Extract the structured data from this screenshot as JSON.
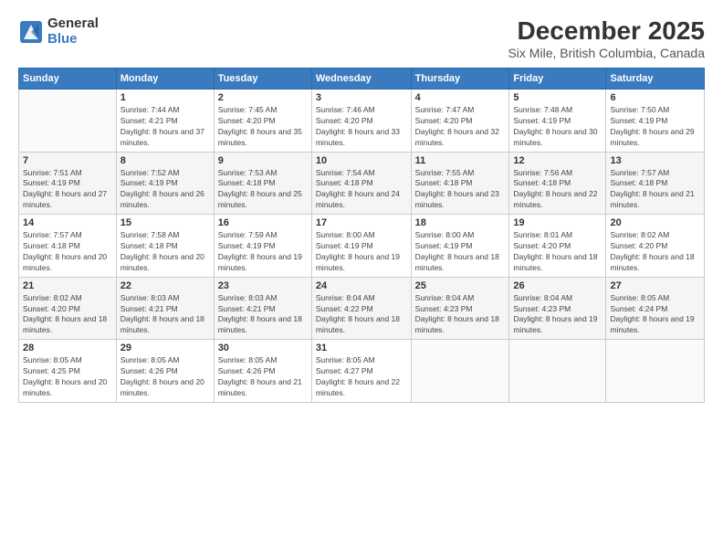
{
  "header": {
    "logo": {
      "general": "General",
      "blue": "Blue"
    },
    "title": "December 2025",
    "subtitle": "Six Mile, British Columbia, Canada"
  },
  "weekdays": [
    "Sunday",
    "Monday",
    "Tuesday",
    "Wednesday",
    "Thursday",
    "Friday",
    "Saturday"
  ],
  "weeks": [
    [
      {
        "day": "",
        "sunrise": "",
        "sunset": "",
        "daylight": ""
      },
      {
        "day": "1",
        "sunrise": "Sunrise: 7:44 AM",
        "sunset": "Sunset: 4:21 PM",
        "daylight": "Daylight: 8 hours and 37 minutes."
      },
      {
        "day": "2",
        "sunrise": "Sunrise: 7:45 AM",
        "sunset": "Sunset: 4:20 PM",
        "daylight": "Daylight: 8 hours and 35 minutes."
      },
      {
        "day": "3",
        "sunrise": "Sunrise: 7:46 AM",
        "sunset": "Sunset: 4:20 PM",
        "daylight": "Daylight: 8 hours and 33 minutes."
      },
      {
        "day": "4",
        "sunrise": "Sunrise: 7:47 AM",
        "sunset": "Sunset: 4:20 PM",
        "daylight": "Daylight: 8 hours and 32 minutes."
      },
      {
        "day": "5",
        "sunrise": "Sunrise: 7:48 AM",
        "sunset": "Sunset: 4:19 PM",
        "daylight": "Daylight: 8 hours and 30 minutes."
      },
      {
        "day": "6",
        "sunrise": "Sunrise: 7:50 AM",
        "sunset": "Sunset: 4:19 PM",
        "daylight": "Daylight: 8 hours and 29 minutes."
      }
    ],
    [
      {
        "day": "7",
        "sunrise": "Sunrise: 7:51 AM",
        "sunset": "Sunset: 4:19 PM",
        "daylight": "Daylight: 8 hours and 27 minutes."
      },
      {
        "day": "8",
        "sunrise": "Sunrise: 7:52 AM",
        "sunset": "Sunset: 4:19 PM",
        "daylight": "Daylight: 8 hours and 26 minutes."
      },
      {
        "day": "9",
        "sunrise": "Sunrise: 7:53 AM",
        "sunset": "Sunset: 4:18 PM",
        "daylight": "Daylight: 8 hours and 25 minutes."
      },
      {
        "day": "10",
        "sunrise": "Sunrise: 7:54 AM",
        "sunset": "Sunset: 4:18 PM",
        "daylight": "Daylight: 8 hours and 24 minutes."
      },
      {
        "day": "11",
        "sunrise": "Sunrise: 7:55 AM",
        "sunset": "Sunset: 4:18 PM",
        "daylight": "Daylight: 8 hours and 23 minutes."
      },
      {
        "day": "12",
        "sunrise": "Sunrise: 7:56 AM",
        "sunset": "Sunset: 4:18 PM",
        "daylight": "Daylight: 8 hours and 22 minutes."
      },
      {
        "day": "13",
        "sunrise": "Sunrise: 7:57 AM",
        "sunset": "Sunset: 4:18 PM",
        "daylight": "Daylight: 8 hours and 21 minutes."
      }
    ],
    [
      {
        "day": "14",
        "sunrise": "Sunrise: 7:57 AM",
        "sunset": "Sunset: 4:18 PM",
        "daylight": "Daylight: 8 hours and 20 minutes."
      },
      {
        "day": "15",
        "sunrise": "Sunrise: 7:58 AM",
        "sunset": "Sunset: 4:18 PM",
        "daylight": "Daylight: 8 hours and 20 minutes."
      },
      {
        "day": "16",
        "sunrise": "Sunrise: 7:59 AM",
        "sunset": "Sunset: 4:19 PM",
        "daylight": "Daylight: 8 hours and 19 minutes."
      },
      {
        "day": "17",
        "sunrise": "Sunrise: 8:00 AM",
        "sunset": "Sunset: 4:19 PM",
        "daylight": "Daylight: 8 hours and 19 minutes."
      },
      {
        "day": "18",
        "sunrise": "Sunrise: 8:00 AM",
        "sunset": "Sunset: 4:19 PM",
        "daylight": "Daylight: 8 hours and 18 minutes."
      },
      {
        "day": "19",
        "sunrise": "Sunrise: 8:01 AM",
        "sunset": "Sunset: 4:20 PM",
        "daylight": "Daylight: 8 hours and 18 minutes."
      },
      {
        "day": "20",
        "sunrise": "Sunrise: 8:02 AM",
        "sunset": "Sunset: 4:20 PM",
        "daylight": "Daylight: 8 hours and 18 minutes."
      }
    ],
    [
      {
        "day": "21",
        "sunrise": "Sunrise: 8:02 AM",
        "sunset": "Sunset: 4:20 PM",
        "daylight": "Daylight: 8 hours and 18 minutes."
      },
      {
        "day": "22",
        "sunrise": "Sunrise: 8:03 AM",
        "sunset": "Sunset: 4:21 PM",
        "daylight": "Daylight: 8 hours and 18 minutes."
      },
      {
        "day": "23",
        "sunrise": "Sunrise: 8:03 AM",
        "sunset": "Sunset: 4:21 PM",
        "daylight": "Daylight: 8 hours and 18 minutes."
      },
      {
        "day": "24",
        "sunrise": "Sunrise: 8:04 AM",
        "sunset": "Sunset: 4:22 PM",
        "daylight": "Daylight: 8 hours and 18 minutes."
      },
      {
        "day": "25",
        "sunrise": "Sunrise: 8:04 AM",
        "sunset": "Sunset: 4:23 PM",
        "daylight": "Daylight: 8 hours and 18 minutes."
      },
      {
        "day": "26",
        "sunrise": "Sunrise: 8:04 AM",
        "sunset": "Sunset: 4:23 PM",
        "daylight": "Daylight: 8 hours and 19 minutes."
      },
      {
        "day": "27",
        "sunrise": "Sunrise: 8:05 AM",
        "sunset": "Sunset: 4:24 PM",
        "daylight": "Daylight: 8 hours and 19 minutes."
      }
    ],
    [
      {
        "day": "28",
        "sunrise": "Sunrise: 8:05 AM",
        "sunset": "Sunset: 4:25 PM",
        "daylight": "Daylight: 8 hours and 20 minutes."
      },
      {
        "day": "29",
        "sunrise": "Sunrise: 8:05 AM",
        "sunset": "Sunset: 4:26 PM",
        "daylight": "Daylight: 8 hours and 20 minutes."
      },
      {
        "day": "30",
        "sunrise": "Sunrise: 8:05 AM",
        "sunset": "Sunset: 4:26 PM",
        "daylight": "Daylight: 8 hours and 21 minutes."
      },
      {
        "day": "31",
        "sunrise": "Sunrise: 8:05 AM",
        "sunset": "Sunset: 4:27 PM",
        "daylight": "Daylight: 8 hours and 22 minutes."
      },
      {
        "day": "",
        "sunrise": "",
        "sunset": "",
        "daylight": ""
      },
      {
        "day": "",
        "sunrise": "",
        "sunset": "",
        "daylight": ""
      },
      {
        "day": "",
        "sunrise": "",
        "sunset": "",
        "daylight": ""
      }
    ]
  ]
}
